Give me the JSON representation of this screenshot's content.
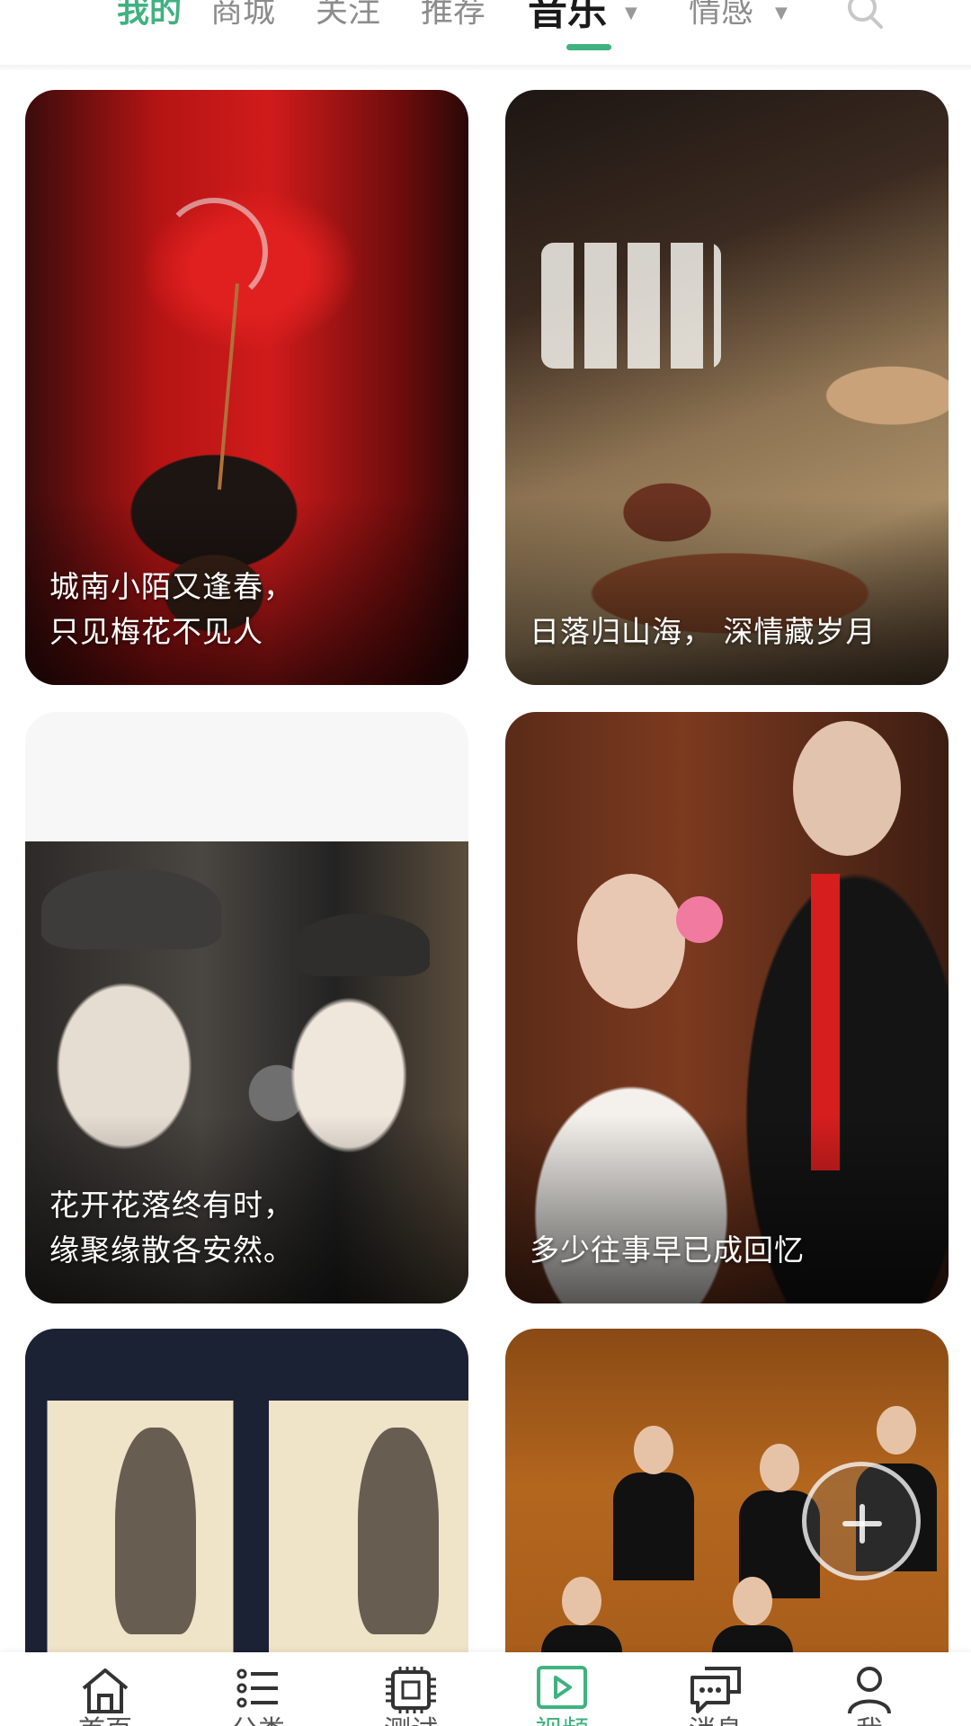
{
  "top_tabs": {
    "items": [
      {
        "label": "我的"
      },
      {
        "label": "商城"
      },
      {
        "label": "关注"
      },
      {
        "label": "推荐"
      },
      {
        "label": "音乐"
      },
      {
        "label": "情感"
      }
    ],
    "active_index": 4,
    "accent_color": "#3fb27f",
    "search_icon": "search-icon"
  },
  "feed": {
    "cards": [
      {
        "caption": "城南小陌又逢春，\n只见梅花不见人"
      },
      {
        "caption": "日落归山海， 深情藏岁月"
      },
      {
        "caption": "花开花落终有时，\n缘聚缘散各安然。"
      },
      {
        "caption": "多少往事早已成回忆"
      },
      {
        "caption": ""
      },
      {
        "caption": ""
      }
    ]
  },
  "fab": {
    "icon": "plus-icon"
  },
  "bottom_nav": {
    "items": [
      {
        "label": "首页",
        "icon": "home-icon"
      },
      {
        "label": "分类",
        "icon": "list-icon"
      },
      {
        "label": "测试",
        "icon": "chip-icon"
      },
      {
        "label": "视频",
        "icon": "play-icon"
      },
      {
        "label": "消息",
        "icon": "chat-icon"
      },
      {
        "label": "我",
        "icon": "user-icon"
      }
    ],
    "active_index": 3
  }
}
